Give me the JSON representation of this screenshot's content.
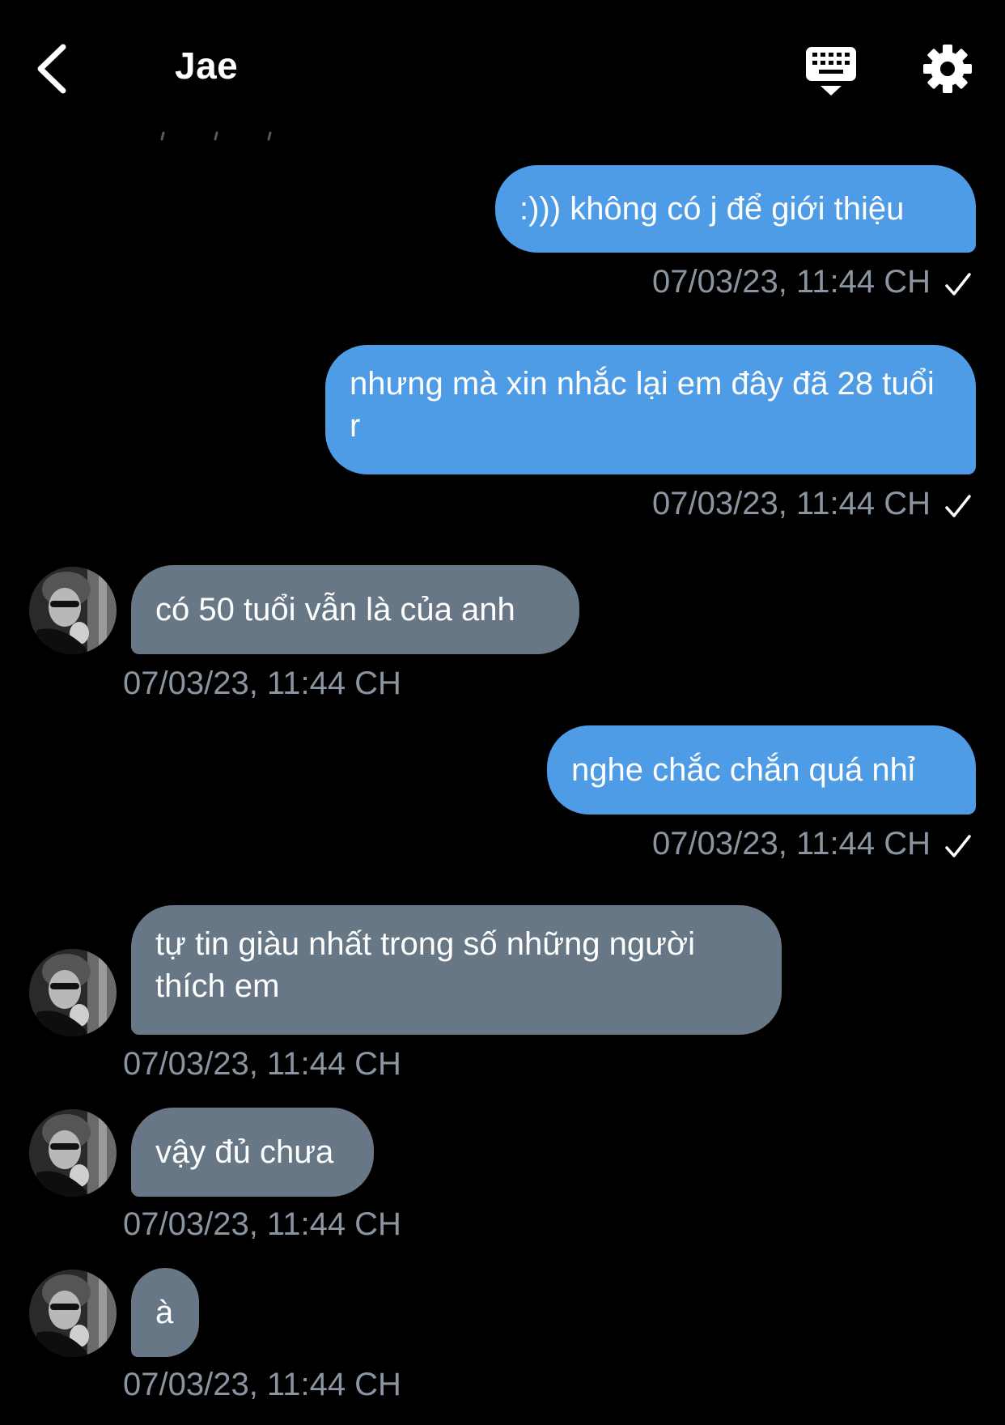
{
  "header": {
    "title": "Jae",
    "back_icon": "chevron-left-icon",
    "keyboard_icon": "keyboard-icon",
    "settings_icon": "gear-icon"
  },
  "colors": {
    "background": "#000000",
    "outgoing_bubble": "#4e9be6",
    "incoming_bubble": "#687786",
    "timestamp": "#8b95a1"
  },
  "messages": [
    {
      "direction": "outgoing",
      "text": ":))) không có j để giới thiệu",
      "time": "07/03/23, 11:44 CH",
      "read": true
    },
    {
      "direction": "outgoing",
      "text": "nhưng mà xin nhắc lại em đây đã 28 tuổi r",
      "time": "07/03/23, 11:44 CH",
      "read": true
    },
    {
      "direction": "incoming",
      "text": "có 50 tuổi vẫn là của anh",
      "time": "07/03/23, 11:44 CH"
    },
    {
      "direction": "outgoing",
      "text": "nghe chắc chắn quá nhỉ",
      "time": "07/03/23, 11:44 CH",
      "read": true
    },
    {
      "direction": "incoming",
      "text": "tự tin  giàu nhất trong số những người thích em",
      "time": "07/03/23, 11:44 CH"
    },
    {
      "direction": "incoming",
      "text": "vậy đủ chưa",
      "time": "07/03/23, 11:44 CH"
    },
    {
      "direction": "incoming",
      "text": "à",
      "time": "07/03/23, 11:44 CH"
    }
  ]
}
